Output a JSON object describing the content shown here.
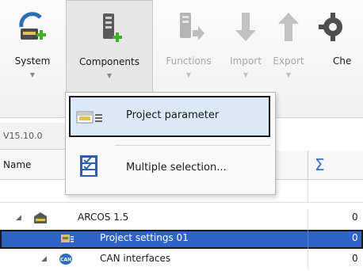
{
  "ribbon": {
    "buttons": [
      {
        "label": "System",
        "icon": "system-add-icon",
        "state": "normal"
      },
      {
        "label": "Components",
        "icon": "components-add-icon",
        "state": "active"
      },
      {
        "label": "Functions",
        "icon": "functions-icon",
        "state": "disabled"
      },
      {
        "label": "Import",
        "icon": "import-arrow-icon",
        "state": "disabled"
      },
      {
        "label": "Export",
        "icon": "export-arrow-icon",
        "state": "disabled"
      },
      {
        "label": "Che",
        "icon": "check-gear-icon",
        "state": "normal"
      }
    ]
  },
  "dropdown": {
    "items": [
      {
        "label": "Project parameter",
        "icon": "project-parameter-icon",
        "highlighted": true
      },
      {
        "label": "Multiple selection...",
        "icon": "multiple-selection-icon",
        "highlighted": false
      }
    ]
  },
  "version_label": "V15.10.0",
  "grid": {
    "name_header": "Name",
    "sum_header": "Σ",
    "rows": [
      {
        "label": "ARCOS 1.5",
        "value": "0",
        "icon": "arcos-device-icon",
        "expander": "◢",
        "selected": false
      },
      {
        "label": "Project settings 01",
        "value": "0",
        "icon": "project-settings-icon",
        "expander": "",
        "selected": true
      },
      {
        "label": "CAN interfaces",
        "value": "0",
        "icon": "can-interface-icon",
        "expander": "◢",
        "selected": false
      }
    ]
  },
  "colors": {
    "selection": "#2f63c6",
    "accent_green": "#3fae2a",
    "sum_blue": "#3a73c4"
  }
}
